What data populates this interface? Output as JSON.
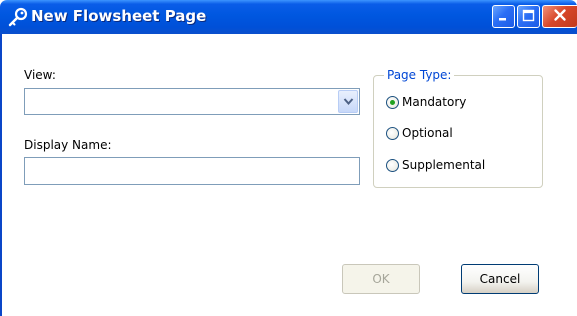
{
  "window": {
    "title": "New Flowsheet Page",
    "controls": [
      "minimize-icon",
      "maximize-icon",
      "close-icon"
    ],
    "title_icon": "key-icon"
  },
  "form": {
    "view_label": "View:",
    "view_value": "",
    "view_dropdown_icon": "chevron-down-icon",
    "display_name_label": "Display Name:",
    "display_name_value": ""
  },
  "page_type": {
    "legend": "Page Type:",
    "options": [
      {
        "label": "Mandatory",
        "selected": true
      },
      {
        "label": "Optional",
        "selected": false
      },
      {
        "label": "Supplemental",
        "selected": false
      }
    ]
  },
  "buttons": {
    "ok_label": "OK",
    "ok_enabled": false,
    "cancel_label": "Cancel"
  },
  "colors": {
    "titlebar": "#0055e5",
    "legend": "#0046d5",
    "radio_selected": "#21a121",
    "field_border": "#7f9db9"
  }
}
